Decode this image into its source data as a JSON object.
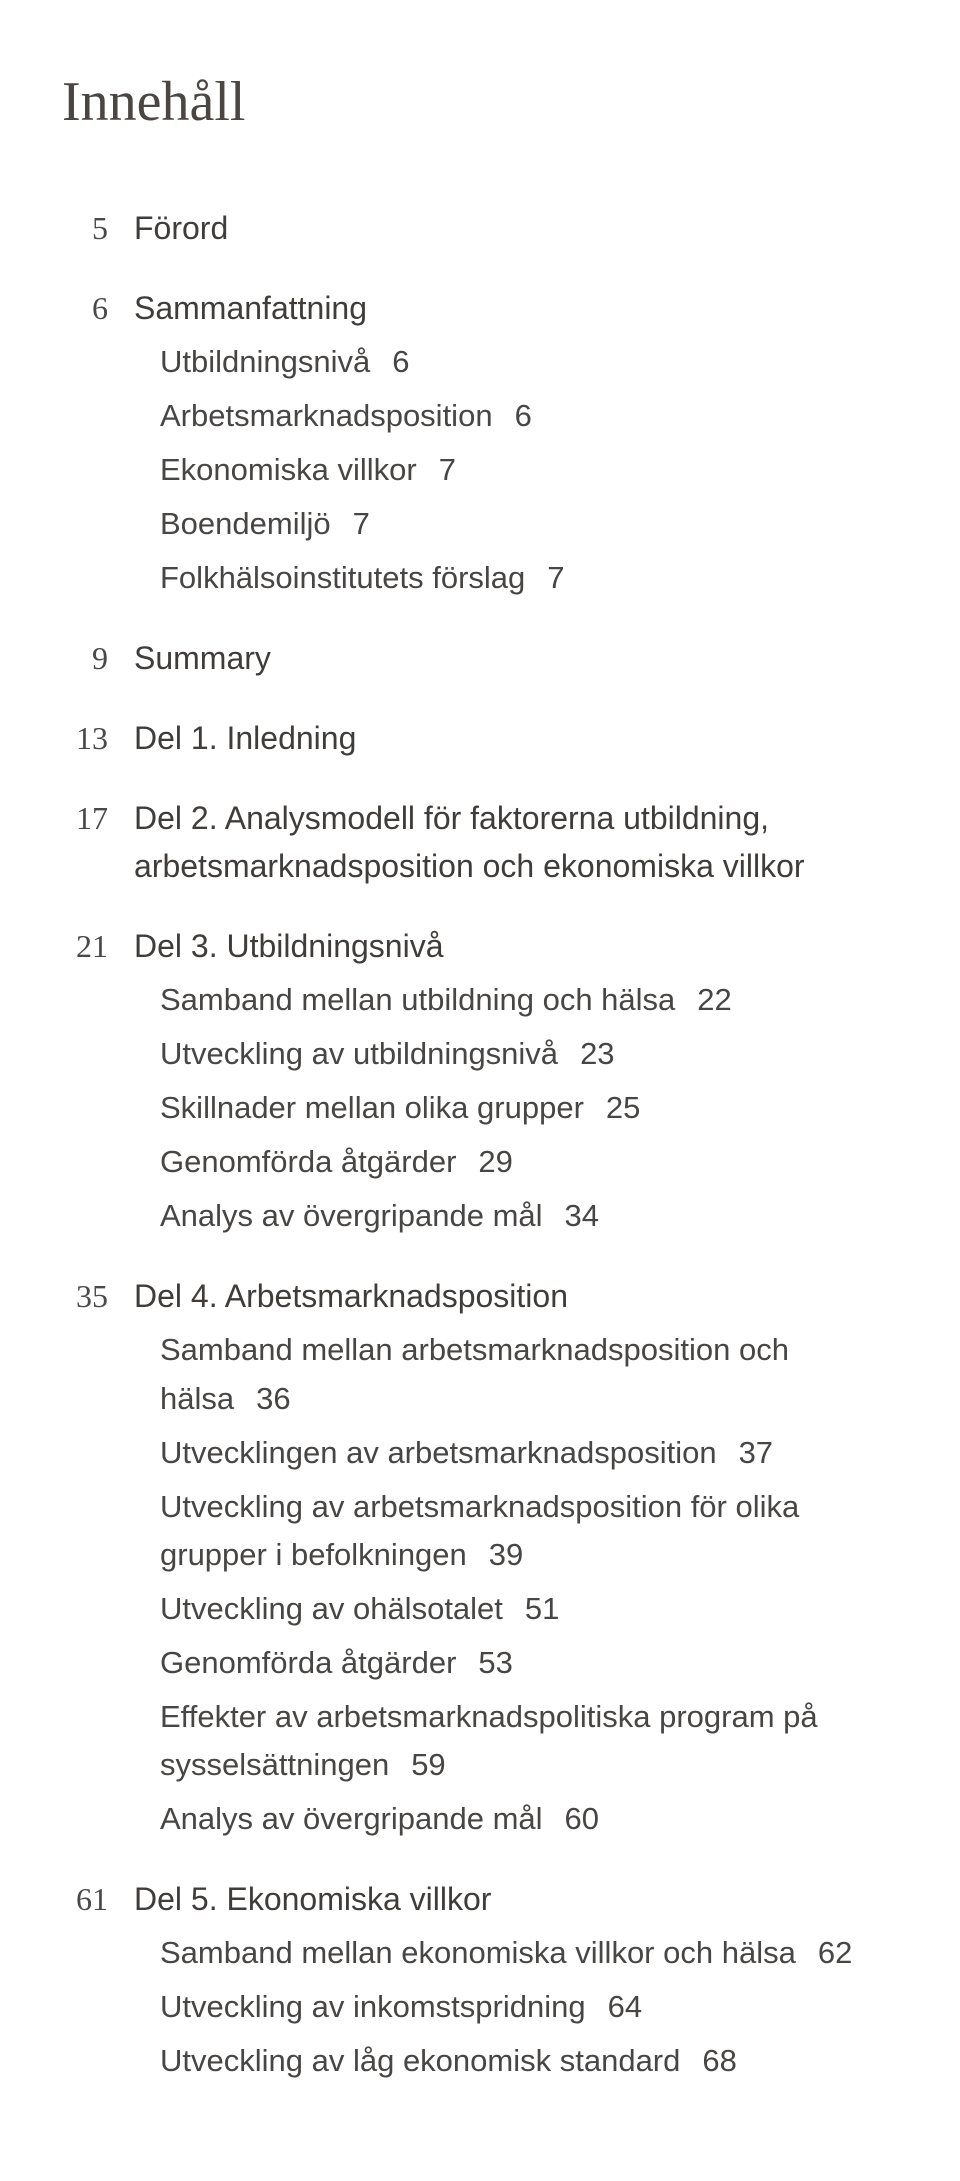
{
  "title": "Innehåll",
  "toc": [
    {
      "page": "5",
      "heading": "Förord"
    },
    {
      "page": "6",
      "heading": "Sammanfattning",
      "subs": [
        {
          "label": "Utbildningsnivå",
          "num": "6"
        },
        {
          "label": "Arbetsmarknadsposition",
          "num": "6"
        },
        {
          "label": "Ekonomiska villkor",
          "num": "7"
        },
        {
          "label": "Boendemiljö",
          "num": "7"
        },
        {
          "label": "Folkhälsoinstitutets förslag",
          "num": "7"
        }
      ]
    },
    {
      "page": "9",
      "heading": "Summary"
    },
    {
      "page": "13",
      "heading": "Del 1. Inledning"
    },
    {
      "page": "17",
      "heading": "Del 2. Analysmodell för faktorerna utbildning, arbetsmarknadsposition och ekonomiska villkor",
      "wrap": true
    },
    {
      "page": "21",
      "heading": "Del 3. Utbildningsnivå",
      "subs": [
        {
          "label": "Samband mellan utbildning och hälsa",
          "num": "22"
        },
        {
          "label": "Utveckling av utbildningsnivå",
          "num": "23"
        },
        {
          "label": "Skillnader mellan olika grupper",
          "num": "25"
        },
        {
          "label": "Genomförda åtgärder",
          "num": "29"
        },
        {
          "label": "Analys av övergripande mål",
          "num": "34"
        }
      ]
    },
    {
      "page": "35",
      "heading": "Del 4. Arbetsmarknadsposition",
      "subs": [
        {
          "label": "Samband mellan arbetsmarknadsposition och hälsa",
          "num": "36"
        },
        {
          "label": "Utvecklingen av arbetsmarknadsposition",
          "num": "37"
        },
        {
          "label": "Utveckling av arbetsmarknadsposition för olika grupper i befolkningen",
          "num": "39",
          "wrap": true
        },
        {
          "label": "Utveckling av ohälsotalet",
          "num": "51"
        },
        {
          "label": "Genomförda åtgärder",
          "num": "53"
        },
        {
          "label": "Effekter av arbetsmarknadspolitiska program på sysselsättningen",
          "num": "59",
          "wrap": true
        },
        {
          "label": "Analys av övergripande mål",
          "num": "60"
        }
      ]
    },
    {
      "page": "61",
      "heading": "Del 5. Ekonomiska villkor",
      "subs": [
        {
          "label": "Samband mellan ekonomiska villkor och hälsa",
          "num": "62"
        },
        {
          "label": "Utveckling av inkomstspridning",
          "num": "64"
        },
        {
          "label": "Utveckling av låg ekonomisk standard",
          "num": "68"
        }
      ]
    }
  ]
}
